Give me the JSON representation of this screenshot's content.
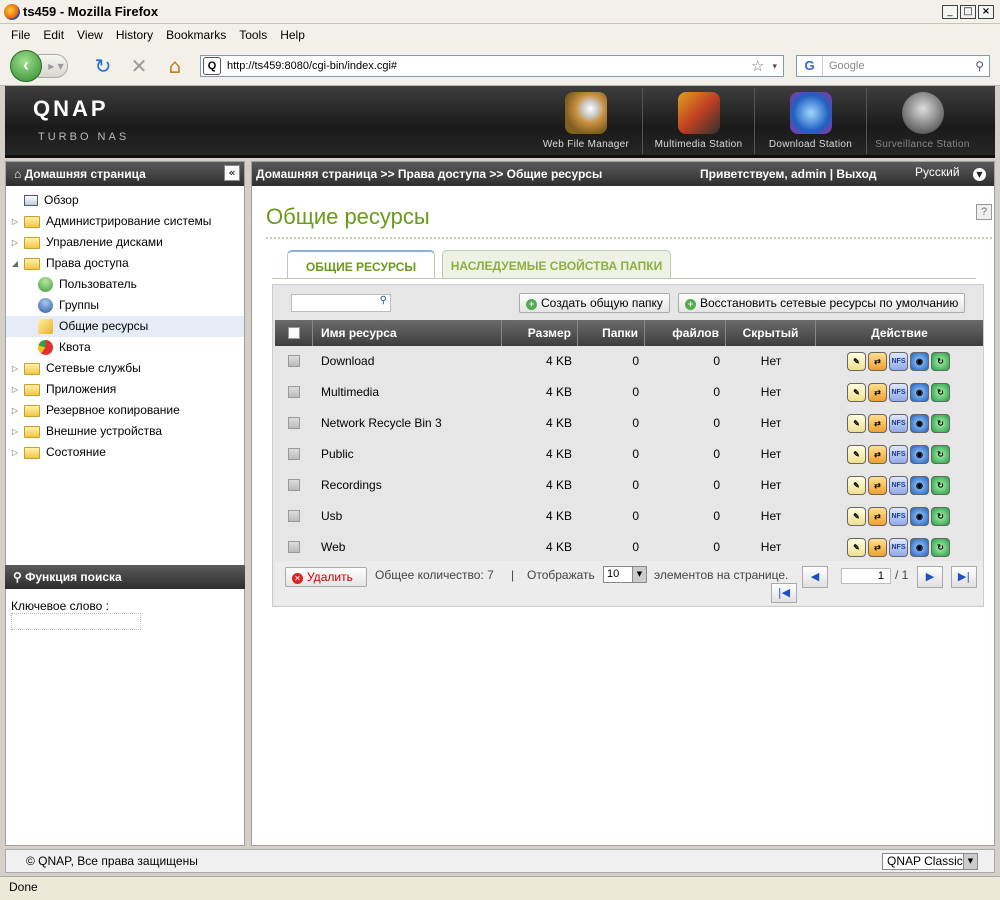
{
  "window": {
    "title": "ts459 - Mozilla Firefox"
  },
  "menubar": [
    "File",
    "Edit",
    "View",
    "History",
    "Bookmarks",
    "Tools",
    "Help"
  ],
  "nav": {
    "url": "http://ts459:8080/cgi-bin/index.cgi#",
    "search_placeholder": "Google"
  },
  "header": {
    "logo": "QNAP",
    "subtitle": "Turbo NAS",
    "apps": [
      "Web File Manager",
      "Multimedia Station",
      "Download Station",
      "Surveillance Station"
    ]
  },
  "sidebar": {
    "title": "Домашняя страница",
    "items": [
      {
        "label": "Обзор",
        "level": 0
      },
      {
        "label": "Администрирование системы",
        "level": 0
      },
      {
        "label": "Управление дисками",
        "level": 0
      },
      {
        "label": "Права доступа",
        "level": 0
      },
      {
        "label": "Пользователь",
        "level": 1
      },
      {
        "label": "Группы",
        "level": 1
      },
      {
        "label": "Общие ресурсы",
        "level": 1,
        "selected": true
      },
      {
        "label": "Квота",
        "level": 1
      },
      {
        "label": "Сетевые службы",
        "level": 0
      },
      {
        "label": "Приложения",
        "level": 0
      },
      {
        "label": "Резервное копирование",
        "level": 0
      },
      {
        "label": "Внешние устройства",
        "level": 0
      },
      {
        "label": "Состояние",
        "level": 0
      }
    ],
    "search": {
      "title": "Функция поиска",
      "keyword_label": "Ключевое слово :"
    }
  },
  "crumb": {
    "path": "Домашняя страница >> Права доступа >> Общие ресурсы",
    "welcome": "Приветствуем,",
    "user": "admin",
    "sep": "|",
    "logout": "Выход",
    "language": "Русский"
  },
  "page": {
    "title": "Общие ресурсы",
    "tabs": [
      "ОБЩИЕ РЕСУРСЫ",
      "НАСЛЕДУЕМЫЕ СВОЙСТВА ПАПКИ"
    ],
    "create_btn": "Создать общую папку",
    "restore_btn": "Восстановить сетевые ресурсы по умолчанию"
  },
  "table": {
    "columns": [
      "Имя ресурса",
      "Размер",
      "Папки",
      "файлов",
      "Скрытый",
      "Действие"
    ],
    "rows": [
      {
        "name": "Download",
        "size": "4 KB",
        "folders": "0",
        "files": "0",
        "hidden": "Нет"
      },
      {
        "name": "Multimedia",
        "size": "4 KB",
        "folders": "0",
        "files": "0",
        "hidden": "Нет"
      },
      {
        "name": "Network Recycle Bin 3",
        "size": "4 KB",
        "folders": "0",
        "files": "0",
        "hidden": "Нет"
      },
      {
        "name": "Public",
        "size": "4 KB",
        "folders": "0",
        "files": "0",
        "hidden": "Нет"
      },
      {
        "name": "Recordings",
        "size": "4 KB",
        "folders": "0",
        "files": "0",
        "hidden": "Нет"
      },
      {
        "name": "Usb",
        "size": "4 KB",
        "folders": "0",
        "files": "0",
        "hidden": "Нет"
      },
      {
        "name": "Web",
        "size": "4 KB",
        "folders": "0",
        "files": "0",
        "hidden": "Нет"
      }
    ],
    "action_icons": [
      "edit-icon",
      "properties-icon",
      "nfs-icon",
      "network-icon",
      "refresh-icon"
    ]
  },
  "footer_bar": {
    "delete": "Удалить",
    "total": "Общее количество: 7",
    "sep": "|",
    "show": "Отображать",
    "per_page": "10",
    "per_page_suffix": "элементов на странице.",
    "page": "1",
    "pages": "/ 1"
  },
  "footer": {
    "copyright": "© QNAP, Все права защищены",
    "skin": "QNAP Classic"
  },
  "status": "Done"
}
